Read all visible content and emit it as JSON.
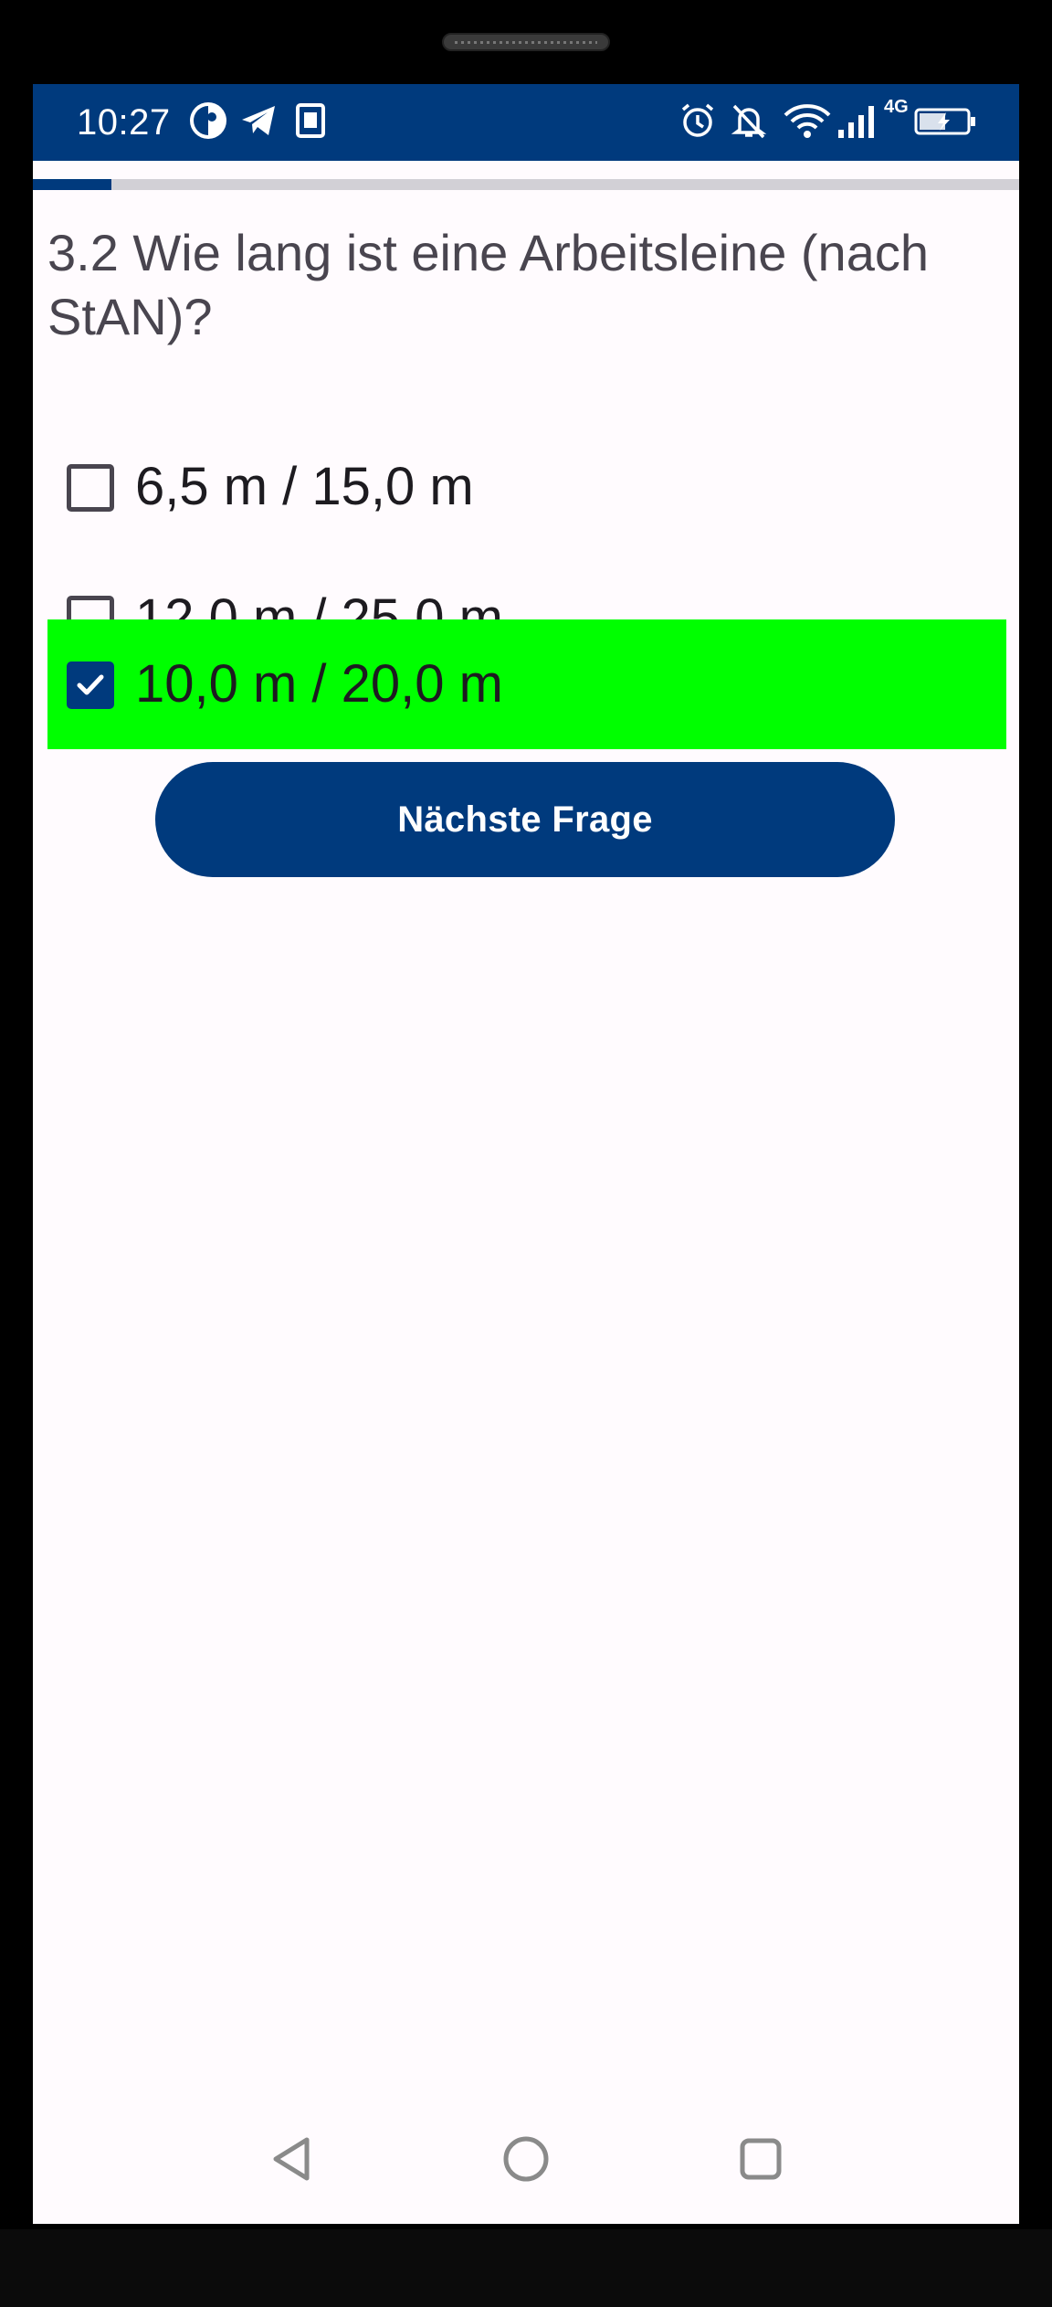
{
  "status_bar": {
    "time": "10:27",
    "left_icons": [
      "circle-app-icon",
      "telegram-icon",
      "notification-app-icon"
    ],
    "right_icons": [
      "alarm-icon",
      "mute-icon",
      "wifi-icon",
      "cell-signal-icon",
      "battery-charging-icon"
    ],
    "network_label": "4G"
  },
  "quiz": {
    "progress_fraction": 0.08,
    "question": "3.2 Wie lang ist eine Arbeitsleine (nach StAN)?",
    "options": [
      {
        "label": "6,5 m / 15,0 m",
        "checked": false,
        "highlighted": false
      },
      {
        "label": "12,0 m / 25,0 m",
        "checked": false,
        "highlighted": false
      },
      {
        "label": "10,0 m / 20,0 m",
        "checked": true,
        "highlighted": true
      }
    ],
    "next_button": "Nächste Frage"
  },
  "colors": {
    "brand": "#003a7d",
    "correct_highlight": "#00ff00",
    "background": "#fffbfe"
  },
  "nav_bar": [
    "back-icon",
    "home-icon",
    "recents-icon"
  ]
}
